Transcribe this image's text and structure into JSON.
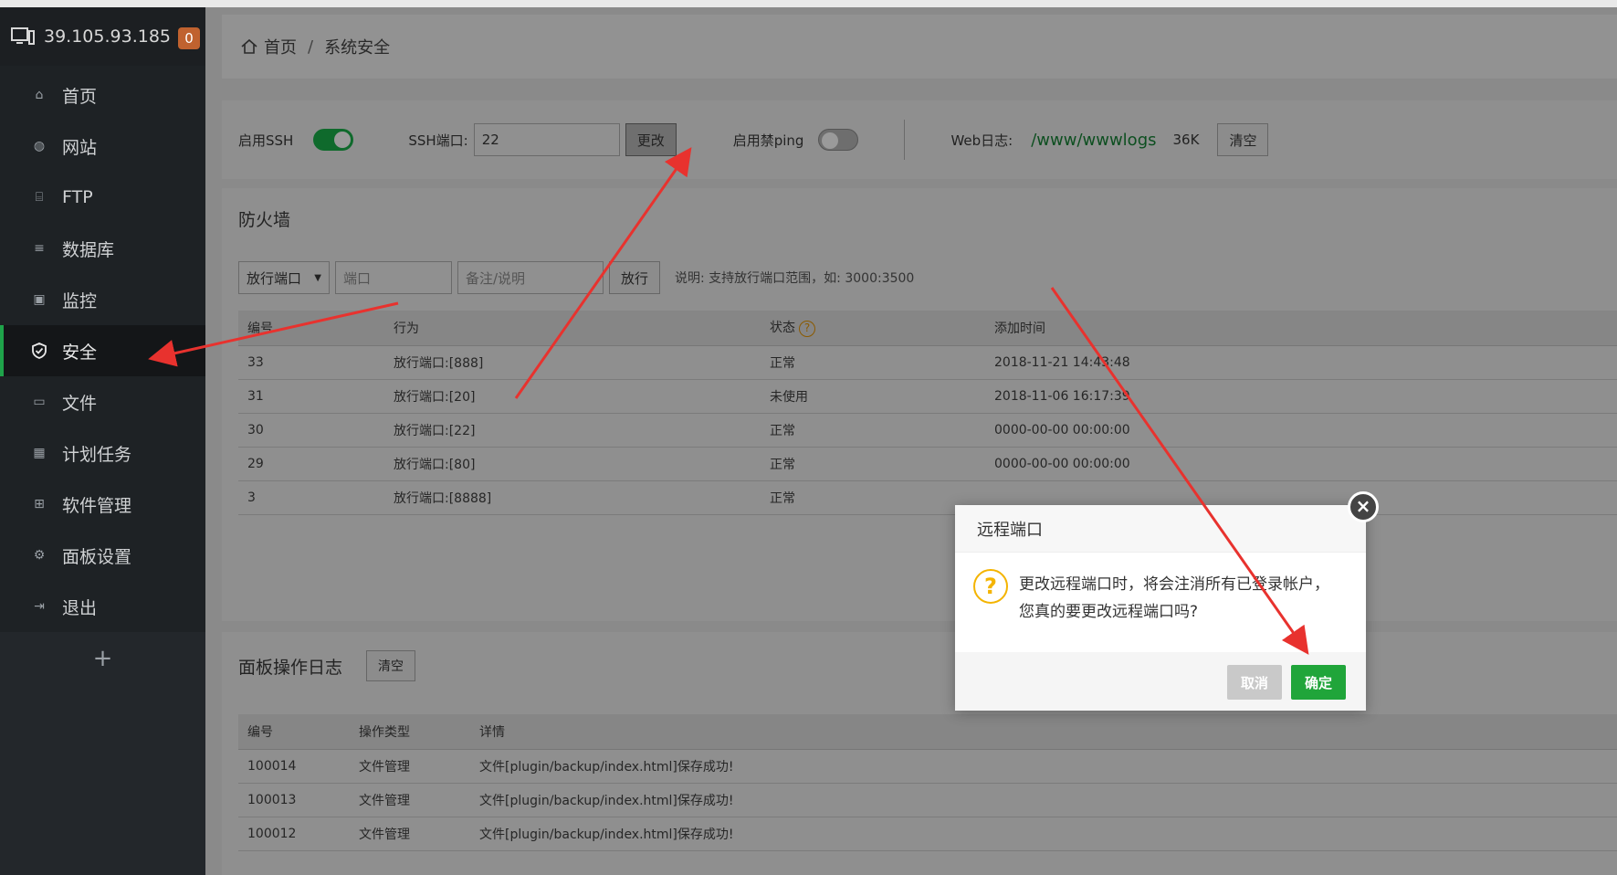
{
  "sidebar": {
    "host": "39.105.93.185",
    "badge": "0",
    "items": [
      {
        "label": "首页",
        "icon": "home-icon"
      },
      {
        "label": "网站",
        "icon": "globe-icon"
      },
      {
        "label": "FTP",
        "icon": "ftp-icon"
      },
      {
        "label": "数据库",
        "icon": "database-icon"
      },
      {
        "label": "监控",
        "icon": "monitor-chart-icon"
      },
      {
        "label": "安全",
        "icon": "shield-icon",
        "active": true
      },
      {
        "label": "文件",
        "icon": "folder-icon"
      },
      {
        "label": "计划任务",
        "icon": "calendar-icon"
      },
      {
        "label": "软件管理",
        "icon": "apps-grid-icon"
      },
      {
        "label": "面板设置",
        "icon": "gear-icon"
      },
      {
        "label": "退出",
        "icon": "logout-icon"
      }
    ],
    "plus": "+"
  },
  "breadcrumb": {
    "home": "首页",
    "separator": "/",
    "current": "系统安全"
  },
  "ssh": {
    "enable_label": "启用SSH",
    "port_label": "SSH端口:",
    "port_value": "22",
    "change_button": "更改",
    "ping_label": "启用禁ping",
    "weblog_label": "Web日志:",
    "weblog_path": "/www/wwwlogs",
    "weblog_size": "36K",
    "clear_button": "清空"
  },
  "firewall": {
    "title": "防火墙",
    "select_value": "放行端口",
    "port_placeholder": "端口",
    "note_placeholder": "备注/说明",
    "allow_button": "放行",
    "hint": "说明: 支持放行端口范围，如: 3000:3500",
    "columns": [
      "编号",
      "行为",
      "状态",
      "添加时间"
    ],
    "rows": [
      {
        "id": "33",
        "action": "放行端口:[888]",
        "status": "正常",
        "time": "2018-11-21 14:43:48"
      },
      {
        "id": "31",
        "action": "放行端口:[20]",
        "status": "未使用",
        "time": "2018-11-06 16:17:39"
      },
      {
        "id": "30",
        "action": "放行端口:[22]",
        "status": "正常",
        "time": "0000-00-00 00:00:00"
      },
      {
        "id": "29",
        "action": "放行端口:[80]",
        "status": "正常",
        "time": "0000-00-00 00:00:00"
      },
      {
        "id": "3",
        "action": "放行端口:[8888]",
        "status": "正常",
        "time": ""
      }
    ]
  },
  "log": {
    "title": "面板操作日志",
    "clear_button": "清空",
    "columns": [
      "编号",
      "操作类型",
      "详情"
    ],
    "rows": [
      {
        "id": "100014",
        "type": "文件管理",
        "detail": "文件[plugin/backup/index.html]保存成功!"
      },
      {
        "id": "100013",
        "type": "文件管理",
        "detail": "文件[plugin/backup/index.html]保存成功!"
      },
      {
        "id": "100012",
        "type": "文件管理",
        "detail": "文件[plugin/backup/index.html]保存成功!"
      }
    ]
  },
  "modal": {
    "title": "远程端口",
    "line1": "更改远程端口时，将会注消所有已登录帐户，",
    "line2": "您真的要更改远程端口吗?",
    "cancel": "取消",
    "ok": "确定",
    "close": "×"
  },
  "colors": {
    "accent": "#20a53a",
    "badge": "#c0622f",
    "arrow": "#e8322e"
  }
}
